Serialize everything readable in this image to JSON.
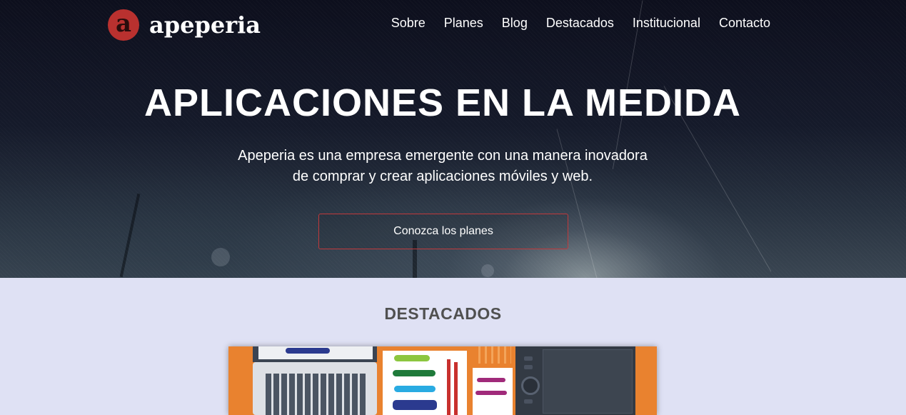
{
  "header": {
    "brand_letter": "a",
    "brand_name": "apeperia",
    "nav": [
      "Sobre",
      "Planes",
      "Blog",
      "Destacados",
      "Institucional",
      "Contacto"
    ]
  },
  "hero": {
    "title": "APLICACIONES EN LA MEDIDA",
    "lead": "Apeperia es una empresa emergente con una manera inovadora de comprar y crear aplicaciones móviles y web.",
    "cta_label": "Conozca los planes"
  },
  "featured": {
    "title": "DESTACADOS",
    "image_icon": "designer-desk-illustration"
  },
  "colors": {
    "brand_red": "#b9312f",
    "cta_border": "#c0393b",
    "section_bg": "#dfe1f4",
    "accent_orange": "#e9822f"
  }
}
